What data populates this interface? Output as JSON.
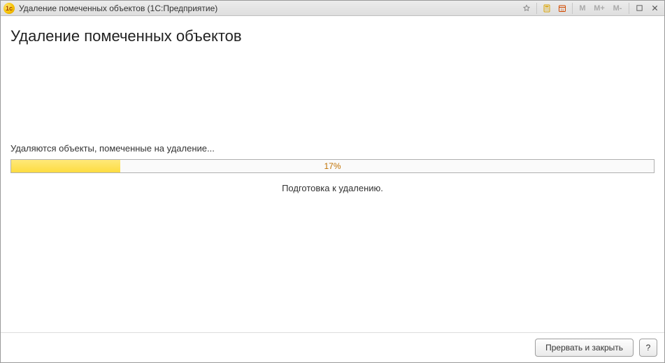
{
  "titlebar": {
    "title": "Удаление помеченных объектов  (1С:Предприятие)",
    "m_label": "M",
    "mplus_label": "M+",
    "mminus_label": "M-"
  },
  "page": {
    "heading": "Удаление помеченных объектов",
    "status": "Удаляются объекты, помеченные на удаление...",
    "substatus": "Подготовка к удалению."
  },
  "progress": {
    "percent": 17,
    "text": "17%"
  },
  "footer": {
    "cancel_label": "Прервать и закрыть",
    "help_label": "?"
  }
}
